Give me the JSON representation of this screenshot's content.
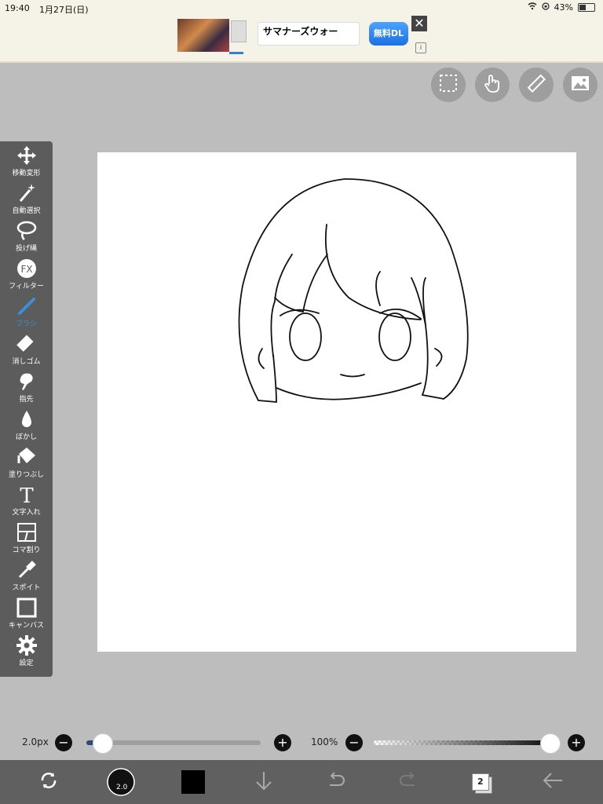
{
  "status": {
    "time": "19:40",
    "date": "1月27日(日)",
    "battery": "43%",
    "battery_level": 0.43
  },
  "ad": {
    "title": "サマナーズウォー",
    "button": "無料DL",
    "close": "✕",
    "info": "i"
  },
  "top_tools": [
    "selection-icon",
    "gesture-icon",
    "ruler-icon",
    "image-icon"
  ],
  "tools": [
    {
      "label": "移動変形",
      "icon": "move-icon"
    },
    {
      "label": "自動選択",
      "icon": "magic-wand-icon"
    },
    {
      "label": "投げ縄",
      "icon": "lasso-icon"
    },
    {
      "label": "フィルター",
      "icon": "fx-icon"
    },
    {
      "label": "ブラシ",
      "icon": "brush-icon",
      "active": true
    },
    {
      "label": "消しゴム",
      "icon": "eraser-icon"
    },
    {
      "label": "指先",
      "icon": "finger-icon"
    },
    {
      "label": "ぼかし",
      "icon": "blur-icon"
    },
    {
      "label": "塗りつぶし",
      "icon": "fill-icon"
    },
    {
      "label": "文字入れ",
      "icon": "text-icon"
    },
    {
      "label": "コマ割り",
      "icon": "frame-icon"
    },
    {
      "label": "スポイト",
      "icon": "eyedropper-icon"
    },
    {
      "label": "キャンバス",
      "icon": "canvas-icon"
    },
    {
      "label": "設定",
      "icon": "gear-icon"
    }
  ],
  "brush": {
    "size_label": "2.0px",
    "size_value": 2.0,
    "opacity_label": "100%",
    "opacity_value": 100
  },
  "bottom": {
    "brush_size_badge": "2.0",
    "layer_count": "2"
  },
  "colors": {
    "accent": "#3a8fd8",
    "toolbar": "#5c5c5c",
    "background": "#bdbdbd",
    "current_color": "#000000"
  }
}
